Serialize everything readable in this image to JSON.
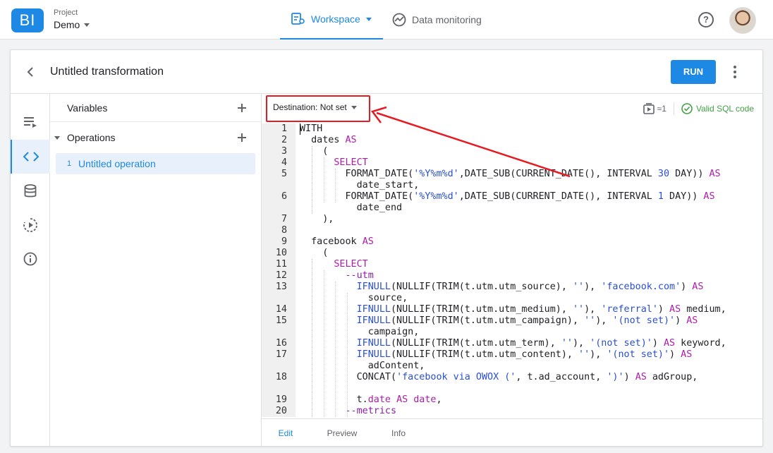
{
  "app": {
    "logo_text": "BI",
    "project_caption": "Project",
    "project_name": "Demo",
    "nav": [
      {
        "label": "Workspace",
        "icon": "workspace-icon",
        "active": true
      },
      {
        "label": "Data monitoring",
        "icon": "monitoring-icon",
        "active": false
      }
    ],
    "help_icon": "?"
  },
  "header": {
    "title": "Untitled transformation",
    "run_label": "RUN"
  },
  "panel": {
    "variables_label": "Variables",
    "operations_label": "Operations",
    "operations": [
      {
        "index": "1",
        "label": "Untitled operation"
      }
    ]
  },
  "editor": {
    "destination_label": "Destination: Not set",
    "operations_count": "≈1",
    "valid_label": "Valid SQL code",
    "tabs": [
      "Edit",
      "Preview",
      "Info"
    ],
    "active_tab": "Edit"
  },
  "colors": {
    "accent": "#1e88e5",
    "valid": "#43a047",
    "highlight": "#e51c23",
    "keyword": "#aa1ea6",
    "string": "#2a4fd0"
  }
}
